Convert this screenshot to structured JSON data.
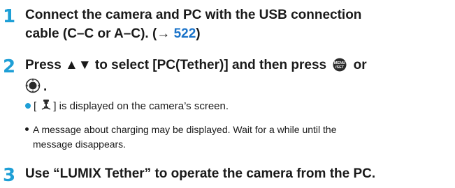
{
  "steps": [
    {
      "number": "1",
      "line1": "Connect the camera and PC with the USB connection",
      "line2_prefix": "cable (C–C or A–C). (→ ",
      "page_link": "522",
      "line2_suffix": ")"
    },
    {
      "number": "2",
      "text_a": "Press ▲▼ to select [PC(Tether)] and then press",
      "text_or": "or",
      "text_end": ".",
      "bullet_pre": "[",
      "bullet_post": "] is displayed on the camera’s screen.",
      "note_line1": "A message about charging may be displayed. Wait for a while until the",
      "note_line2": "message disappears."
    },
    {
      "number": "3",
      "text": "Use “LUMIX Tether” to operate the camera from the PC."
    }
  ],
  "icons": {
    "menu_set": "menu-set-button-icon",
    "joystick": "joystick-button-icon",
    "tether": "tether-connection-icon"
  },
  "colors": {
    "step_number": "#1e9fd6",
    "link": "#1a73c9",
    "text": "#1a1a1a"
  }
}
